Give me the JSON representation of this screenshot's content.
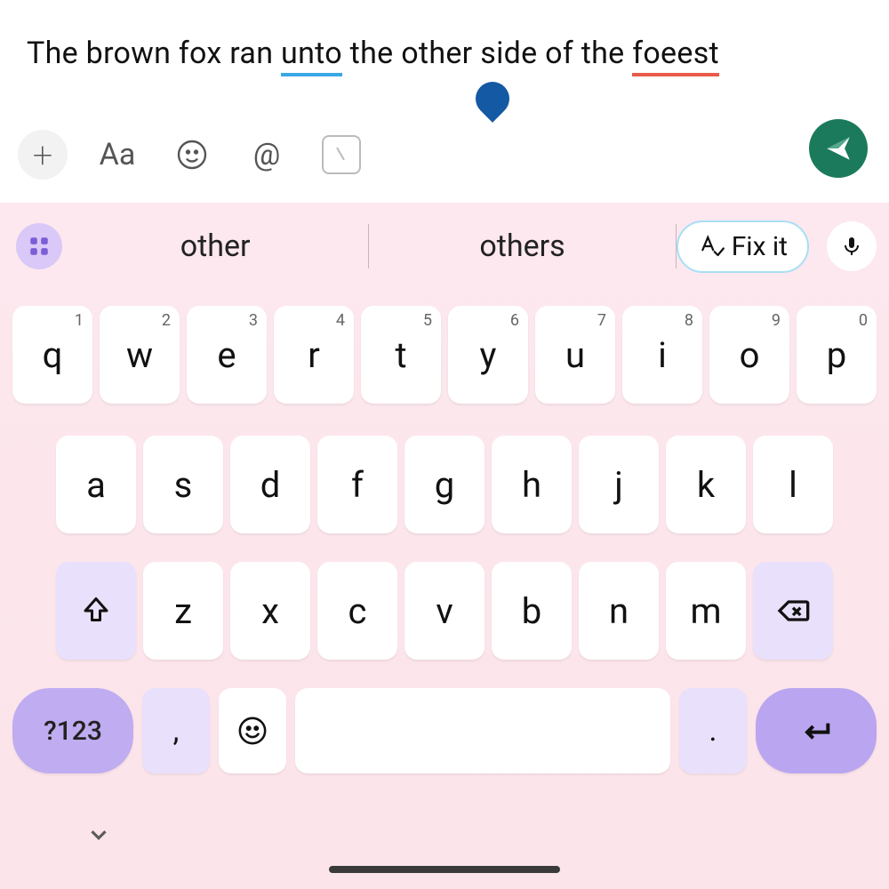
{
  "input": {
    "prefix": "The brown fox ran ",
    "word_unto": "unto",
    "mid": " the other side of the ",
    "word_foeest": "foeest"
  },
  "toolbar": {
    "plus": "+",
    "aa": "Aa",
    "at": "@"
  },
  "suggestions": {
    "s1": "other",
    "s2": "others",
    "fixit_label": "Fix it"
  },
  "keys": {
    "row1": [
      "q",
      "w",
      "e",
      "r",
      "t",
      "y",
      "u",
      "i",
      "o",
      "p"
    ],
    "row1_hints": [
      "1",
      "2",
      "3",
      "4",
      "5",
      "6",
      "7",
      "8",
      "9",
      "0"
    ],
    "row2": [
      "a",
      "s",
      "d",
      "f",
      "g",
      "h",
      "j",
      "k",
      "l"
    ],
    "row3": [
      "z",
      "x",
      "c",
      "v",
      "b",
      "n",
      "m"
    ],
    "symbols": "?123",
    "comma": ",",
    "period": "."
  }
}
